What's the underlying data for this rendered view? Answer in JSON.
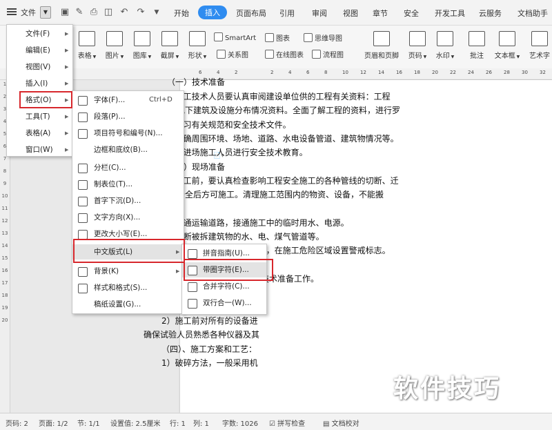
{
  "topbar": {
    "file_label": "文件",
    "tabs": [
      {
        "label": "开始"
      },
      {
        "label": "插入",
        "active": true
      },
      {
        "label": "页面布局"
      },
      {
        "label": "引用"
      },
      {
        "label": "审阅"
      },
      {
        "label": "视图"
      },
      {
        "label": "章节"
      },
      {
        "label": "安全"
      },
      {
        "label": "开发工具"
      },
      {
        "label": "云服务"
      },
      {
        "label": "文档助手"
      }
    ],
    "quick_icons": [
      "save-icon",
      "format-painter-icon",
      "print-icon",
      "preview-icon",
      "undo-icon",
      "redo-icon",
      "customize-icon"
    ]
  },
  "ribbon": {
    "big": [
      "表格",
      "图片",
      "图库",
      "截屏",
      "形状"
    ],
    "smartart": "SmartArt",
    "chart": "图表",
    "mindmap": "思维导图",
    "relation": "关系图",
    "online_chart": "在线图表",
    "flowchart": "流程图",
    "header_footer": "页眉和页脚",
    "page_num": "页码",
    "watermark": "水印",
    "comment": "批注",
    "textbox": "文本框",
    "wordart": "艺术字"
  },
  "ruler": {
    "numbers": [
      "6",
      "4",
      "2",
      "2",
      "4",
      "6",
      "8",
      "10",
      "12",
      "14",
      "16",
      "18",
      "20",
      "22",
      "24",
      "26",
      "28",
      "30",
      "32",
      "34",
      "36"
    ]
  },
  "vruler": {
    "numbers": [
      "1",
      "2",
      "3",
      "4",
      "5",
      "6",
      "7",
      "8",
      "9",
      "10",
      "11",
      "12",
      "13",
      "14",
      "15",
      "16",
      "17",
      "18",
      "19",
      "20"
    ]
  },
  "menu_main": {
    "items": [
      {
        "label": "文件(F)"
      },
      {
        "label": "编辑(E)"
      },
      {
        "label": "视图(V)"
      },
      {
        "label": "插入(I)"
      },
      {
        "label": "格式(O)"
      },
      {
        "label": "工具(T)"
      },
      {
        "label": "表格(A)"
      },
      {
        "label": "窗口(W)"
      }
    ]
  },
  "menu_format": {
    "items": [
      {
        "label": "字体(F)...",
        "shortcut": "Ctrl+D",
        "icon": "font-icon"
      },
      {
        "label": "段落(P)...",
        "icon": "paragraph-icon"
      },
      {
        "label": "项目符号和编号(N)...",
        "icon": "bullets-icon"
      },
      {
        "label": "边框和底纹(B)...",
        "icon": ""
      },
      {
        "label": "分栏(C)...",
        "icon": "columns-icon"
      },
      {
        "label": "制表位(T)...",
        "icon": "tab-stop-icon"
      },
      {
        "label": "首字下沉(D)...",
        "icon": "drop-cap-icon"
      },
      {
        "label": "文字方向(X)...",
        "icon": "text-direction-icon"
      },
      {
        "label": "更改大小写(E)...",
        "icon": "change-case-icon"
      },
      {
        "label": "中文版式(L)",
        "icon": ""
      },
      {
        "label": "背景(K)",
        "icon": "background-icon"
      },
      {
        "label": "样式和格式(S)...",
        "icon": "styles-icon"
      },
      {
        "label": "稿纸设置(G)...",
        "icon": ""
      }
    ]
  },
  "menu_chinese": {
    "items": [
      {
        "label": "拼音指南(U)...",
        "icon": "phonetic-guide-icon"
      },
      {
        "label": "带圈字符(E)...",
        "icon": "enclosed-char-icon"
      },
      {
        "label": "合并字符(C)...",
        "icon": "combine-chars-icon"
      },
      {
        "label": "双行合一(W)...",
        "icon": "two-lines-icon"
      }
    ]
  },
  "document": {
    "lines": [
      "（一）技术准备",
      "1、施工技术人员要认真审阅建设单位供的工程有关资料：工程",
      "的地上、地下建筑及设施分布情况资料。全面了解工程的资料，进行罗",
      "2、学习有关规范和安全技术文件。",
      "3、明确周围环境、场地、道路、水电设备管道、建筑物情况等。",
      "4、向进场施工人员进行安全技术教育。",
      "（二）现场准备",
      "1、施工前，要认真检查影响工程安全施工的各种管线的切断、迁",
      "毕，确认安全后方可施工。清理施工范围内的物资、设备，不能搬",
      "防护。",
      "2、疏通运输道路，接通施工中的临时用水、电源。",
      "3、切断被拆建筑物的水、电、煤气管道等。",
      "4、向周围群众出示安民告示，在施工危险区域设置警戒标志。",
      "（三）施工准备",
      "施工人员进场后，立即进行技术准备工作。",
      "1）组织施工人员认真熟悉",
      "主提出。",
      "2）施工前对所有的设备进",
      "确保试验人员熟悉各种仪器及其",
      "（四）、施工方案和工艺：",
      "1）破碎方法，一般采用机"
    ]
  },
  "watermark_text": "软件技巧",
  "status": {
    "page_code": "页码: 2",
    "page": "页面: 1/2",
    "section": "节: 1/1",
    "setting": "设置值: 2.5厘米",
    "row": "行: 1",
    "col": "列: 1",
    "words": "字数: 1026",
    "spell": "拼写检查",
    "proof": "文档校对"
  }
}
